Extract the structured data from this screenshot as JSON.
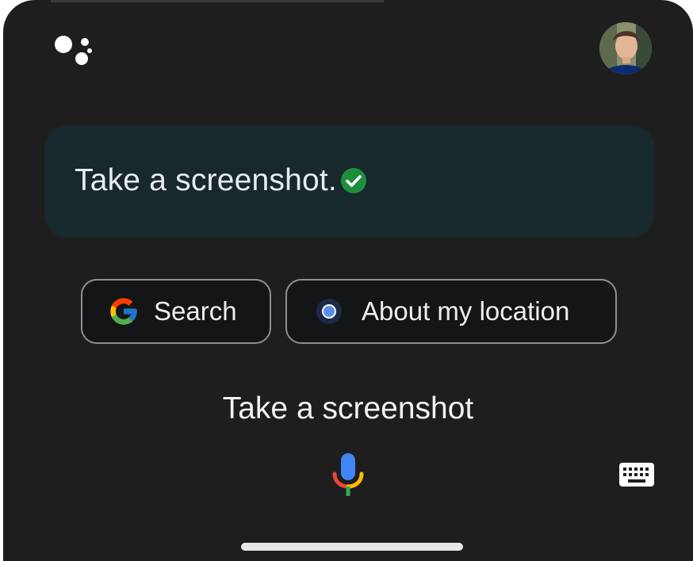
{
  "app": {
    "logo_icon": "google-assistant-icon",
    "avatar_icon": "user-avatar"
  },
  "query": {
    "text": "Take a screenshot.",
    "status_icon": "check-circle-icon",
    "status_color": "#1e8e3e"
  },
  "chips": [
    {
      "label": "Search",
      "icon": "google-g-icon"
    },
    {
      "label": "About my location",
      "icon": "location-dot-icon",
      "icon_color": "#5b8def"
    }
  ],
  "transcript": {
    "text": "Take a screenshot"
  },
  "input": {
    "mic_icon": "microphone-icon",
    "keyboard_icon": "keyboard-icon"
  },
  "colors": {
    "background": "#1e1e1e",
    "card": "#17292c",
    "chip_border": "#8d9093"
  }
}
